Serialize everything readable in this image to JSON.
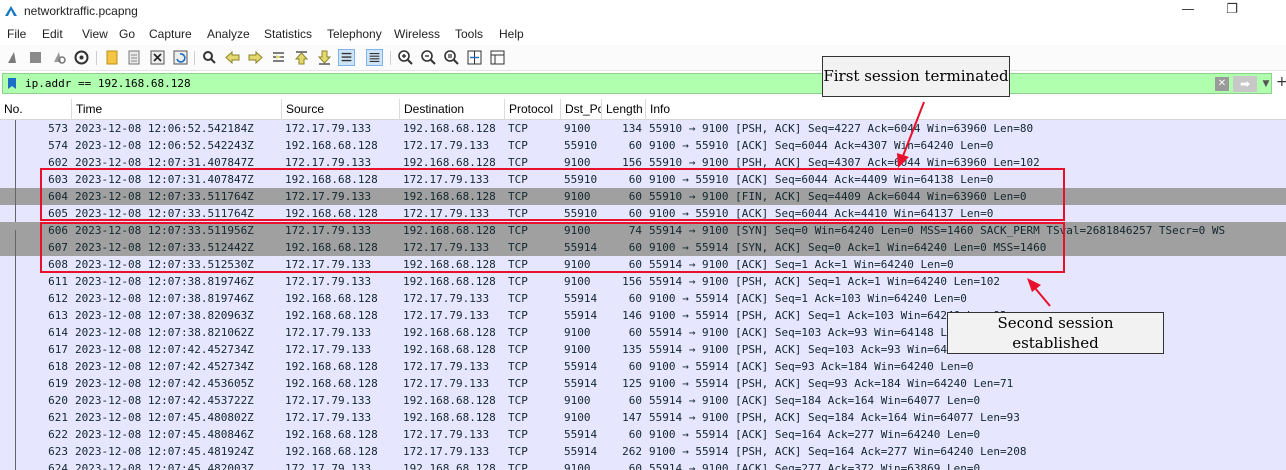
{
  "window": {
    "title": "networktraffic.pcapng",
    "minimize_glyph": "—",
    "maximize_glyph": "❐"
  },
  "menu": [
    "File",
    "Edit",
    "View",
    "Go",
    "Capture",
    "Analyze",
    "Statistics",
    "Telephony",
    "Wireless",
    "Tools",
    "Help"
  ],
  "toolbar_icons": [
    "shark-fin-start-icon",
    "stop-capture-icon",
    "restart-capture-icon",
    "capture-options-icon",
    "open-file-icon",
    "save-file-icon",
    "close-file-icon",
    "reload-file-icon",
    "find-packet-icon",
    "go-back-icon",
    "go-forward-icon",
    "go-to-packet-icon",
    "go-first-icon",
    "go-last-icon",
    "autoscroll-icon",
    "colorize-icon",
    "zoom-in-icon",
    "zoom-out-icon",
    "zoom-normal-icon",
    "resize-columns-icon",
    "layout-icon"
  ],
  "filter": {
    "value": "ip.addr == 192.168.68.128",
    "clear_glyph": "✕",
    "apply_glyph": "➡",
    "dropdown_glyph": "▼",
    "add_glyph": "+"
  },
  "columns": [
    "No.",
    "Time",
    "Source",
    "Destination",
    "Protocol",
    "Dst_Po",
    "Length",
    "Info"
  ],
  "packets": [
    {
      "no": "573",
      "time": "2023-12-08 12:06:52.542184Z",
      "src": "172.17.79.133",
      "dst": "192.168.68.128",
      "proto": "TCP",
      "dport": "9100",
      "len": "134",
      "info": "55910 → 9100 [PSH, ACK] Seq=4227 Ack=6044 Win=63960 Len=80"
    },
    {
      "no": "574",
      "time": "2023-12-08 12:06:52.542243Z",
      "src": "192.168.68.128",
      "dst": "172.17.79.133",
      "proto": "TCP",
      "dport": "55910",
      "len": "60",
      "info": "9100 → 55910 [ACK] Seq=6044 Ack=4307 Win=64240 Len=0"
    },
    {
      "no": "602",
      "time": "2023-12-08 12:07:31.407847Z",
      "src": "172.17.79.133",
      "dst": "192.168.68.128",
      "proto": "TCP",
      "dport": "9100",
      "len": "156",
      "info": "55910 → 9100 [PSH, ACK] Seq=4307 Ack=6044 Win=63960 Len=102"
    },
    {
      "no": "603",
      "time": "2023-12-08 12:07:31.407847Z",
      "src": "192.168.68.128",
      "dst": "172.17.79.133",
      "proto": "TCP",
      "dport": "55910",
      "len": "60",
      "info": "9100 → 55910 [ACK] Seq=6044 Ack=4409 Win=64138 Len=0"
    },
    {
      "no": "604",
      "time": "2023-12-08 12:07:33.511764Z",
      "src": "172.17.79.133",
      "dst": "192.168.68.128",
      "proto": "TCP",
      "dport": "9100",
      "len": "60",
      "info": "55910 → 9100 [FIN, ACK] Seq=4409 Ack=6044 Win=63960 Len=0"
    },
    {
      "no": "605",
      "time": "2023-12-08 12:07:33.511764Z",
      "src": "192.168.68.128",
      "dst": "172.17.79.133",
      "proto": "TCP",
      "dport": "55910",
      "len": "60",
      "info": "9100 → 55910 [ACK] Seq=6044 Ack=4410 Win=64137 Len=0"
    },
    {
      "no": "606",
      "time": "2023-12-08 12:07:33.511956Z",
      "src": "172.17.79.133",
      "dst": "192.168.68.128",
      "proto": "TCP",
      "dport": "9100",
      "len": "74",
      "info": "55914 → 9100 [SYN] Seq=0 Win=64240 Len=0 MSS=1460 SACK_PERM TSval=2681846257 TSecr=0 WS"
    },
    {
      "no": "607",
      "time": "2023-12-08 12:07:33.512442Z",
      "src": "192.168.68.128",
      "dst": "172.17.79.133",
      "proto": "TCP",
      "dport": "55914",
      "len": "60",
      "info": "9100 → 55914 [SYN, ACK] Seq=0 Ack=1 Win=64240 Len=0 MSS=1460"
    },
    {
      "no": "608",
      "time": "2023-12-08 12:07:33.512530Z",
      "src": "172.17.79.133",
      "dst": "192.168.68.128",
      "proto": "TCP",
      "dport": "9100",
      "len": "60",
      "info": "55914 → 9100 [ACK] Seq=1 Ack=1 Win=64240 Len=0"
    },
    {
      "no": "611",
      "time": "2023-12-08 12:07:38.819746Z",
      "src": "172.17.79.133",
      "dst": "192.168.68.128",
      "proto": "TCP",
      "dport": "9100",
      "len": "156",
      "info": "55914 → 9100 [PSH, ACK] Seq=1 Ack=1 Win=64240 Len=102"
    },
    {
      "no": "612",
      "time": "2023-12-08 12:07:38.819746Z",
      "src": "192.168.68.128",
      "dst": "172.17.79.133",
      "proto": "TCP",
      "dport": "55914",
      "len": "60",
      "info": "9100 → 55914 [ACK] Seq=1 Ack=103 Win=64240 Len=0"
    },
    {
      "no": "613",
      "time": "2023-12-08 12:07:38.820963Z",
      "src": "192.168.68.128",
      "dst": "172.17.79.133",
      "proto": "TCP",
      "dport": "55914",
      "len": "146",
      "info": "9100 → 55914 [PSH, ACK] Seq=1 Ack=103 Win=64240 Len=92"
    },
    {
      "no": "614",
      "time": "2023-12-08 12:07:38.821062Z",
      "src": "172.17.79.133",
      "dst": "192.168.68.128",
      "proto": "TCP",
      "dport": "9100",
      "len": "60",
      "info": "55914 → 9100 [ACK] Seq=103 Ack=93 Win=64148 Len=0"
    },
    {
      "no": "617",
      "time": "2023-12-08 12:07:42.452734Z",
      "src": "172.17.79.133",
      "dst": "192.168.68.128",
      "proto": "TCP",
      "dport": "9100",
      "len": "135",
      "info": "55914 → 9100 [PSH, ACK] Seq=103 Ack=93 Win=64148 Len=81"
    },
    {
      "no": "618",
      "time": "2023-12-08 12:07:42.452734Z",
      "src": "192.168.68.128",
      "dst": "172.17.79.133",
      "proto": "TCP",
      "dport": "55914",
      "len": "60",
      "info": "9100 → 55914 [ACK] Seq=93 Ack=184 Win=64240 Len=0"
    },
    {
      "no": "619",
      "time": "2023-12-08 12:07:42.453605Z",
      "src": "192.168.68.128",
      "dst": "172.17.79.133",
      "proto": "TCP",
      "dport": "55914",
      "len": "125",
      "info": "9100 → 55914 [PSH, ACK] Seq=93 Ack=184 Win=64240 Len=71"
    },
    {
      "no": "620",
      "time": "2023-12-08 12:07:42.453722Z",
      "src": "172.17.79.133",
      "dst": "192.168.68.128",
      "proto": "TCP",
      "dport": "9100",
      "len": "60",
      "info": "55914 → 9100 [ACK] Seq=184 Ack=164 Win=64077 Len=0"
    },
    {
      "no": "621",
      "time": "2023-12-08 12:07:45.480802Z",
      "src": "172.17.79.133",
      "dst": "192.168.68.128",
      "proto": "TCP",
      "dport": "9100",
      "len": "147",
      "info": "55914 → 9100 [PSH, ACK] Seq=184 Ack=164 Win=64077 Len=93"
    },
    {
      "no": "622",
      "time": "2023-12-08 12:07:45.480846Z",
      "src": "192.168.68.128",
      "dst": "172.17.79.133",
      "proto": "TCP",
      "dport": "55914",
      "len": "60",
      "info": "9100 → 55914 [ACK] Seq=164 Ack=277 Win=64240 Len=0"
    },
    {
      "no": "623",
      "time": "2023-12-08 12:07:45.481924Z",
      "src": "192.168.68.128",
      "dst": "172.17.79.133",
      "proto": "TCP",
      "dport": "55914",
      "len": "262",
      "info": "9100 → 55914 [PSH, ACK] Seq=164 Ack=277 Win=64240 Len=208"
    },
    {
      "no": "624",
      "time": "2023-12-08 12:07:45.482003Z",
      "src": "172.17.79.133",
      "dst": "192.168.68.128",
      "proto": "TCP",
      "dport": "9100",
      "len": "60",
      "info": "55914 → 9100 [ACK] Seq=277 Ack=372 Win=63869 Len=0"
    }
  ],
  "annotations": {
    "first_label": "First session terminated",
    "second_label_line1": "Second session",
    "second_label_line2": "established"
  },
  "colors": {
    "filter_valid": "#afffaf",
    "tcp_row": "#e7e6ff",
    "syn_fin_row": "#a0a0a0",
    "annotation_red": "#e8102a"
  }
}
